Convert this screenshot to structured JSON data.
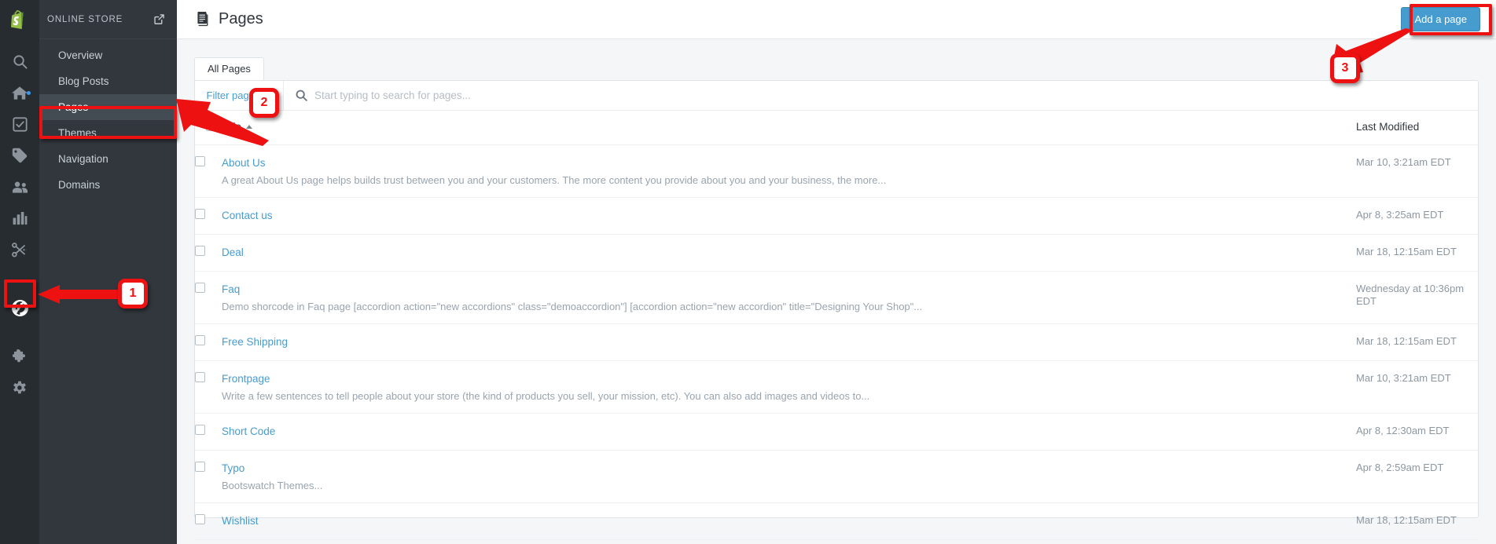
{
  "rail": {
    "logo_icon": "shopify-bag-logo",
    "icons": [
      {
        "name": "search-icon",
        "active": false,
        "dot": false
      },
      {
        "name": "home-icon",
        "active": false,
        "dot": true
      },
      {
        "name": "orders-checkbox-icon",
        "active": false,
        "dot": false
      },
      {
        "name": "products-tag-icon",
        "active": false,
        "dot": false
      },
      {
        "name": "customers-icon",
        "active": false,
        "dot": false
      },
      {
        "name": "analytics-bar-chart-icon",
        "active": false,
        "dot": false
      },
      {
        "name": "discounts-scissors-icon",
        "active": false,
        "dot": false
      },
      {
        "name": "online-store-globe-icon",
        "active": true,
        "dot": false
      },
      {
        "name": "apps-puzzle-icon",
        "active": false,
        "dot": false
      },
      {
        "name": "settings-gear-icon",
        "active": false,
        "dot": false
      }
    ]
  },
  "secnav": {
    "title": "ONLINE STORE",
    "external_link_icon": "external-link-icon",
    "items": [
      {
        "label": "Overview",
        "selected": false
      },
      {
        "label": "Blog Posts",
        "selected": false
      },
      {
        "label": "Pages",
        "selected": true
      },
      {
        "label": "Themes",
        "selected": false
      },
      {
        "label": "Navigation",
        "selected": false
      },
      {
        "label": "Domains",
        "selected": false
      }
    ]
  },
  "topbar": {
    "page_icon": "pages-document-icon",
    "title": "Pages",
    "add_page_label": "Add a page"
  },
  "tabs": [
    {
      "label": "All Pages",
      "active": true
    }
  ],
  "filter": {
    "select_label": "Filter pages",
    "search_placeholder": "Start typing to search for pages...",
    "search_value": "",
    "search_icon": "search-icon"
  },
  "table": {
    "columns": {
      "title": "Title",
      "last_modified": "Last Modified"
    },
    "sort": "asc",
    "rows": [
      {
        "title": "About Us",
        "description": "A great About Us page helps builds trust between you and your customers. The more content you provide about you and your business, the more...",
        "modified": "Mar 10, 3:21am EDT"
      },
      {
        "title": "Contact us",
        "description": "",
        "modified": "Apr 8, 3:25am EDT"
      },
      {
        "title": "Deal",
        "description": "",
        "modified": "Mar 18, 12:15am EDT"
      },
      {
        "title": "Faq",
        "description": "Demo shorcode in Faq page [accordion action=\"new accordions\" class=\"demoaccordion\"] [accordion action=\"new accordion\" title=\"Designing Your Shop\"...",
        "modified": "Wednesday at 10:36pm EDT"
      },
      {
        "title": "Free Shipping",
        "description": "",
        "modified": "Mar 18, 12:15am EDT"
      },
      {
        "title": "Frontpage",
        "description": "Write a few sentences to tell people about your store (the kind of products you sell, your mission, etc). You can also add images and videos to...",
        "modified": "Mar 10, 3:21am EDT"
      },
      {
        "title": "Short Code",
        "description": "",
        "modified": "Apr 8, 12:30am EDT"
      },
      {
        "title": "Typo",
        "description": "Bootswatch Themes...",
        "modified": "Apr 8, 2:59am EDT"
      },
      {
        "title": "Wishlist",
        "description": "",
        "modified": "Mar 18, 12:15am EDT"
      }
    ]
  },
  "annotations": {
    "color": "#ee1111",
    "markers": [
      {
        "number": "1",
        "target": "online-store-globe-icon"
      },
      {
        "number": "2",
        "target": "sidebar-item-pages"
      },
      {
        "number": "3",
        "target": "add-page-button"
      }
    ]
  }
}
